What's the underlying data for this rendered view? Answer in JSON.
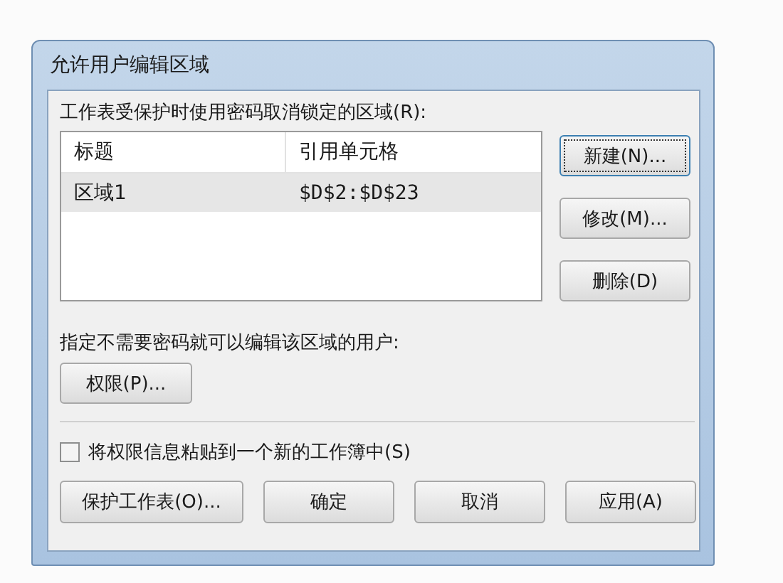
{
  "window": {
    "title": "允许用户编辑区域"
  },
  "ranges_label": "工作表受保护时使用密码取消锁定的区域(R):",
  "table": {
    "columns": [
      "标题",
      "引用单元格"
    ],
    "rows": [
      {
        "cells": [
          "区域1",
          "$D$2:$D$23"
        ],
        "selected": true
      }
    ]
  },
  "side_buttons": [
    {
      "label": "新建(N)...",
      "focused": true
    },
    {
      "label": "修改(M)...",
      "focused": false
    },
    {
      "label": "删除(D)",
      "focused": false
    }
  ],
  "users_label": "指定不需要密码就可以编辑该区域的用户:",
  "permissions_button": "权限(P)...",
  "paste_checkbox": {
    "label": "将权限信息粘贴到一个新的工作簿中(S)",
    "checked": false
  },
  "footer_buttons": [
    "保护工作表(O)...",
    "确定",
    "取消",
    "应用(A)"
  ]
}
